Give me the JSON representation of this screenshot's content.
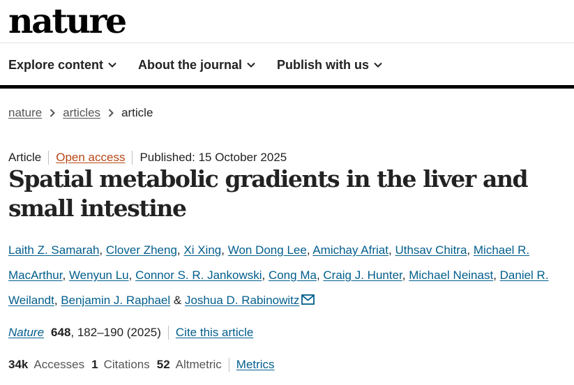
{
  "site": {
    "logo": "nature"
  },
  "nav": {
    "items": [
      {
        "label": "Explore content",
        "icon": "chevron-down-icon"
      },
      {
        "label": "About the journal",
        "icon": "chevron-down-icon"
      },
      {
        "label": "Publish with us",
        "icon": "chevron-down-icon"
      }
    ]
  },
  "breadcrumb": {
    "items": [
      "nature",
      "articles"
    ],
    "current": "article"
  },
  "article": {
    "type": "Article",
    "access": "Open access",
    "published": "Published: 15 October 2025",
    "title": "Spatial metabolic gradients in the liver and small intestine",
    "authors": [
      "Laith Z. Samarah",
      "Clover Zheng",
      "Xi Xing",
      "Won Dong Lee",
      "Amichay Afriat",
      "Uthsav Chitra",
      "Michael R. MacArthur",
      "Wenyun Lu",
      "Connor S. R. Jankowski",
      "Cong Ma",
      "Craig J. Hunter",
      "Michael Neinast",
      "Daniel R. Weilandt",
      "Benjamin J. Raphael",
      "Joshua D. Rabinowitz"
    ],
    "author_separator": ", ",
    "author_last_separator": " & ",
    "citation": {
      "journal": "Nature",
      "volume": "648",
      "pages": ", 182–190 (2025)",
      "cite_label": "Cite this article"
    }
  },
  "metrics": {
    "accesses_value": "34k",
    "accesses_label": "Accesses",
    "citations_value": "1",
    "citations_label": "Citations",
    "altmetric_value": "52",
    "altmetric_label": "Altmetric",
    "link_label": "Metrics"
  },
  "colors": {
    "link": "#025e8d",
    "open_access": "#b74616",
    "text": "#222222",
    "muted": "#555555"
  }
}
